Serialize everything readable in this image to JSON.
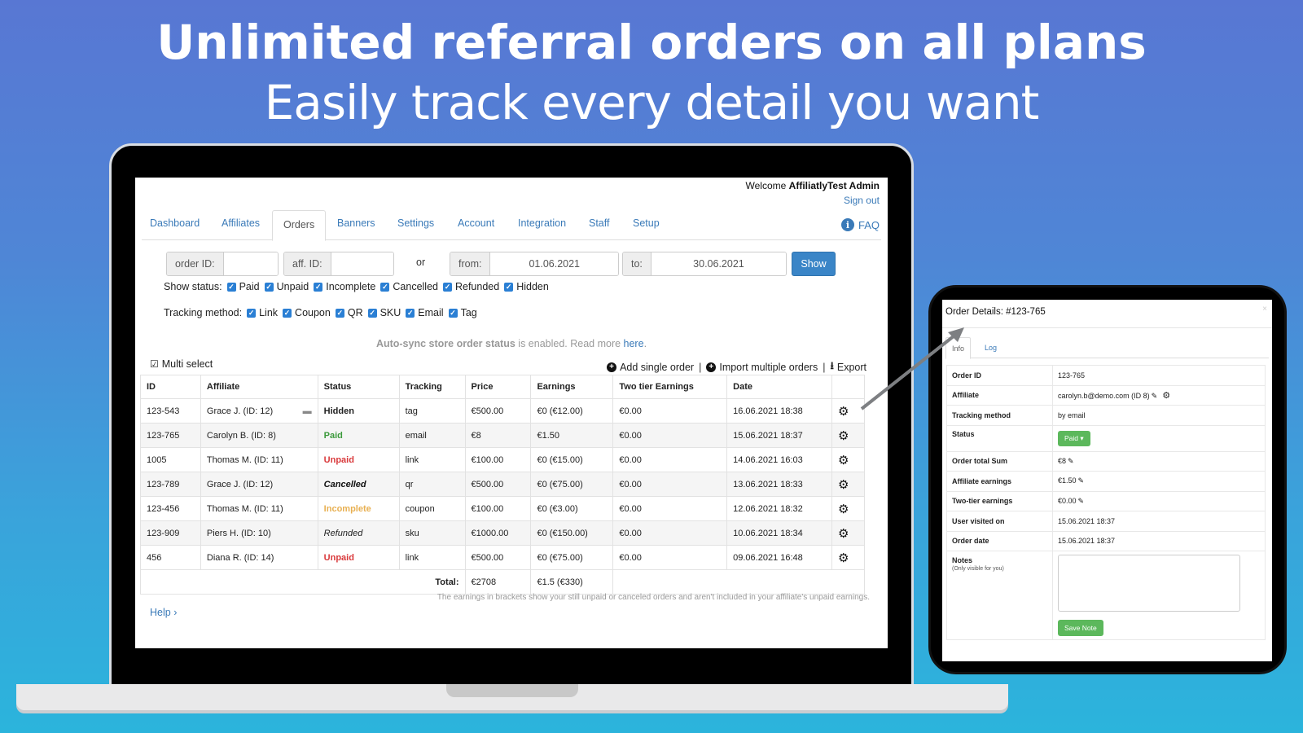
{
  "promo": {
    "headline": "Unlimited referral orders on all plans",
    "subline": "Easily track every detail you want"
  },
  "header": {
    "welcome_prefix": "Welcome",
    "user_name": "AffiliatlyTest Admin",
    "sign_out": "Sign out",
    "faq": "FAQ"
  },
  "nav": {
    "tabs": [
      {
        "label": "Dashboard"
      },
      {
        "label": "Affiliates"
      },
      {
        "label": "Orders",
        "active": true
      },
      {
        "label": "Banners"
      },
      {
        "label": "Settings"
      },
      {
        "label": "Account"
      },
      {
        "label": "Integration"
      },
      {
        "label": "Staff"
      },
      {
        "label": "Setup"
      }
    ]
  },
  "filters": {
    "order_id_label": "order ID:",
    "order_id_value": "",
    "aff_id_label": "aff. ID:",
    "aff_id_value": "",
    "or_label": "or",
    "from_label": "from:",
    "from_value": "01.06.2021",
    "to_label": "to:",
    "to_value": "30.06.2021",
    "show_button": "Show"
  },
  "status_filter": {
    "label": "Show status:",
    "options": [
      {
        "label": "Paid",
        "checked": true
      },
      {
        "label": "Unpaid",
        "checked": true
      },
      {
        "label": "Incomplete",
        "checked": true
      },
      {
        "label": "Cancelled",
        "checked": true
      },
      {
        "label": "Refunded",
        "checked": true
      },
      {
        "label": "Hidden",
        "checked": true
      }
    ]
  },
  "tracking_filter": {
    "label": "Tracking method:",
    "options": [
      {
        "label": "Link",
        "checked": true
      },
      {
        "label": "Coupon",
        "checked": true
      },
      {
        "label": "QR",
        "checked": true
      },
      {
        "label": "SKU",
        "checked": true
      },
      {
        "label": "Email",
        "checked": true
      },
      {
        "label": "Tag",
        "checked": true
      }
    ]
  },
  "autosync": {
    "bold": "Auto-sync store order status",
    "rest": " is enabled. Read more ",
    "link": "here",
    "end": "."
  },
  "toolbar": {
    "multi_select": "Multi select",
    "add_single": "Add single order",
    "import_multiple": "Import multiple orders",
    "export": "Export"
  },
  "table": {
    "columns": [
      "ID",
      "Affiliate",
      "Status",
      "Tracking",
      "Price",
      "Earnings",
      "Two tier Earnings",
      "Date",
      ""
    ],
    "rows": [
      {
        "id": "123-543",
        "affiliate": "Grace J. (ID: 12)",
        "has_comment": true,
        "status": "Hidden",
        "status_class": "st-hidden",
        "tracking": "tag",
        "price": "€500.00",
        "earnings": "€0 (€12.00)",
        "two_tier": "€0.00",
        "date": "16.06.2021 18:38"
      },
      {
        "id": "123-765",
        "affiliate": "Carolyn B. (ID: 8)",
        "has_comment": false,
        "status": "Paid",
        "status_class": "st-paid",
        "tracking": "email",
        "price": "€8",
        "earnings": "€1.50",
        "two_tier": "€0.00",
        "date": "15.06.2021 18:37"
      },
      {
        "id": "1005",
        "affiliate": "Thomas M. (ID: 11)",
        "has_comment": false,
        "status": "Unpaid",
        "status_class": "st-unpaid",
        "tracking": "link",
        "price": "€100.00",
        "earnings": "€0 (€15.00)",
        "two_tier": "€0.00",
        "date": "14.06.2021 16:03"
      },
      {
        "id": "123-789",
        "affiliate": "Grace J. (ID: 12)",
        "has_comment": false,
        "status": "Cancelled",
        "status_class": "st-cancelled",
        "tracking": "qr",
        "price": "€500.00",
        "earnings": "€0 (€75.00)",
        "two_tier": "€0.00",
        "date": "13.06.2021 18:33"
      },
      {
        "id": "123-456",
        "affiliate": "Thomas M. (ID: 11)",
        "has_comment": false,
        "status": "Incomplete",
        "status_class": "st-incomplete",
        "tracking": "coupon",
        "price": "€100.00",
        "earnings": "€0 (€3.00)",
        "two_tier": "€0.00",
        "date": "12.06.2021 18:32"
      },
      {
        "id": "123-909",
        "affiliate": "Piers H. (ID: 10)",
        "has_comment": false,
        "status": "Refunded",
        "status_class": "st-refunded",
        "tracking": "sku",
        "price": "€1000.00",
        "earnings": "€0 (€150.00)",
        "two_tier": "€0.00",
        "date": "10.06.2021 18:34"
      },
      {
        "id": "456",
        "affiliate": "Diana R. (ID: 14)",
        "has_comment": false,
        "status": "Unpaid",
        "status_class": "st-unpaid",
        "tracking": "link",
        "price": "€500.00",
        "earnings": "€0 (€75.00)",
        "two_tier": "€0.00",
        "date": "09.06.2021 16:48"
      }
    ],
    "total_label": "Total:",
    "total_price": "€2708",
    "total_earnings": "€1.5 (€330)"
  },
  "footnote": "The earnings in brackets show your still unpaid or canceled orders and aren't included in your affiliate's unpaid earnings.",
  "help": "Help",
  "order_details": {
    "title": "Order Details: #123-765",
    "close": "×",
    "tabs": [
      {
        "label": "Info",
        "active": true
      },
      {
        "label": "Log"
      }
    ],
    "fields": {
      "order_id": {
        "label": "Order ID",
        "value": "123-765"
      },
      "affiliate": {
        "label": "Affiliate",
        "value": "carolyn.b@demo.com (ID 8)"
      },
      "tracking": {
        "label": "Tracking method",
        "value": "by email"
      },
      "status": {
        "label": "Status",
        "value": "Paid"
      },
      "order_total": {
        "label": "Order total Sum",
        "value": "€8"
      },
      "aff_earnings": {
        "label": "Affiliate earnings",
        "value": "€1.50"
      },
      "two_tier": {
        "label": "Two-tier earnings",
        "value": "€0.00"
      },
      "visited": {
        "label": "User visited on",
        "value": "15.06.2021 18:37"
      },
      "order_date": {
        "label": "Order date",
        "value": "15.06.2021 18:37"
      },
      "notes": {
        "label": "Notes",
        "sublabel": "(Only visible for you)",
        "value": ""
      }
    },
    "save_note": "Save Note"
  }
}
